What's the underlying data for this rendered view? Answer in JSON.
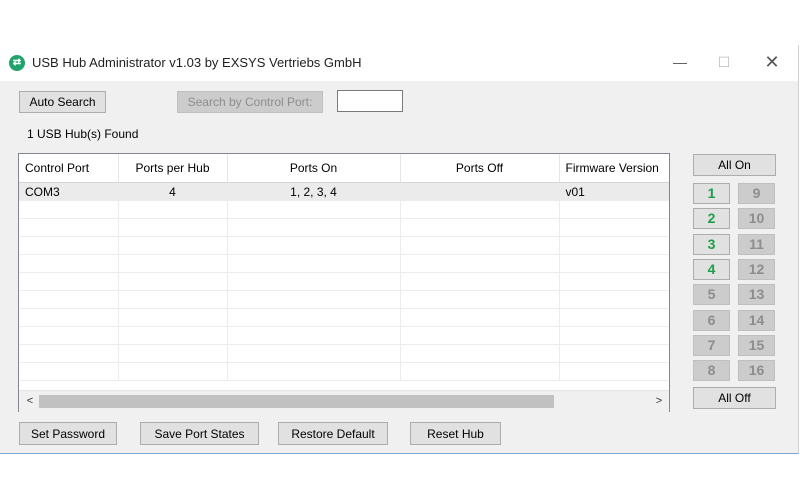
{
  "window": {
    "title": "USB Hub Administrator v1.03 by EXSYS Vertriebs GmbH",
    "controls": {
      "minimize": "—",
      "maximize": "☐",
      "close": "✕"
    }
  },
  "toolbar": {
    "auto_search": "Auto Search",
    "search_by_port": "Search by Control Port:",
    "port_input_value": ""
  },
  "status": {
    "found": "1 USB Hub(s) Found"
  },
  "grid": {
    "columns": [
      "Control Port",
      "Ports per Hub",
      "Ports On",
      "Ports Off",
      "Firmware Version"
    ],
    "rows": [
      [
        "COM3",
        "4",
        "1, 2, 3, 4",
        "",
        "v01"
      ]
    ]
  },
  "scrollbar": {
    "left_arrow": "<",
    "right_arrow": ">"
  },
  "ports": {
    "all_on": "All On",
    "all_off": "All Off",
    "left": [
      {
        "label": "1",
        "on": true
      },
      {
        "label": "2",
        "on": true
      },
      {
        "label": "3",
        "on": true
      },
      {
        "label": "4",
        "on": true
      },
      {
        "label": "5",
        "on": false
      },
      {
        "label": "6",
        "on": false
      },
      {
        "label": "7",
        "on": false
      },
      {
        "label": "8",
        "on": false
      }
    ],
    "right": [
      {
        "label": "9",
        "on": false
      },
      {
        "label": "10",
        "on": false
      },
      {
        "label": "11",
        "on": false
      },
      {
        "label": "12",
        "on": false
      },
      {
        "label": "13",
        "on": false
      },
      {
        "label": "14",
        "on": false
      },
      {
        "label": "15",
        "on": false
      },
      {
        "label": "16",
        "on": false
      }
    ]
  },
  "footer": {
    "set_password": "Set Password",
    "save_states": "Save Port States",
    "restore_default": "Restore Default",
    "reset_hub": "Reset Hub"
  },
  "colors": {
    "port_on": "#1e9e4a",
    "port_off": "#8d8d8d",
    "app_icon": "#1fa36b"
  }
}
